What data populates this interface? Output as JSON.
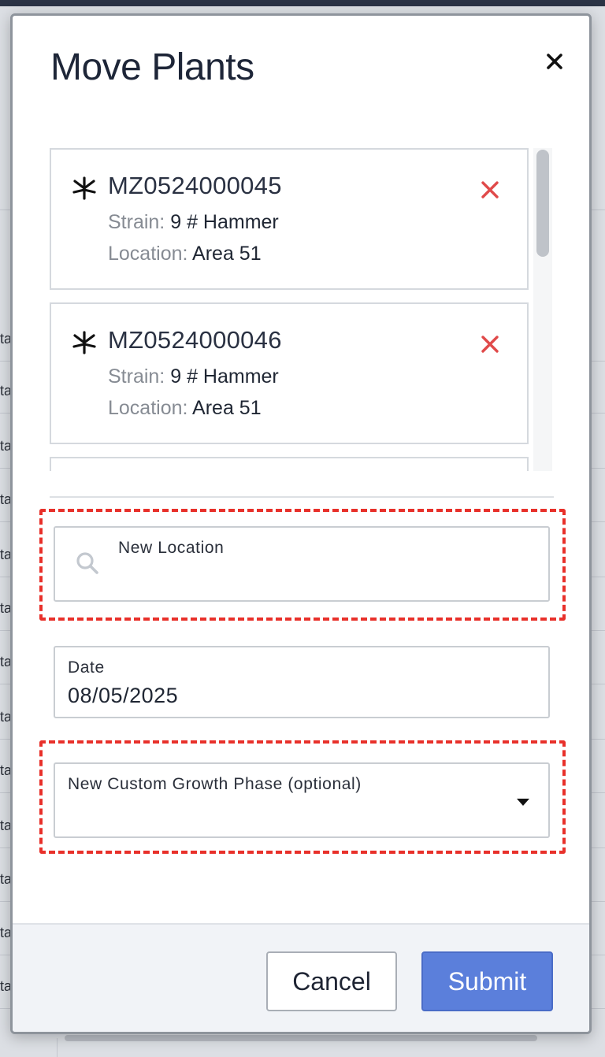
{
  "background": {
    "row_fragments": [
      "ta",
      "ta",
      "ta",
      "ta",
      "ta",
      "ta",
      "ta",
      "ta",
      "ta",
      "ta",
      "ta",
      "ta",
      "ta"
    ]
  },
  "modal": {
    "title": "Move Plants",
    "close_icon": "close-icon"
  },
  "plants": [
    {
      "id": "MZ0524000045",
      "strain_label": "Strain:",
      "strain": "9 # Hammer",
      "location_label": "Location:",
      "location": "Area 51"
    },
    {
      "id": "MZ0524000046",
      "strain_label": "Strain:",
      "strain": "9 # Hammer",
      "location_label": "Location:",
      "location": "Area 51"
    }
  ],
  "form": {
    "new_location": {
      "label": "New Location",
      "value": ""
    },
    "date": {
      "label": "Date",
      "value": "08/05/2025"
    },
    "growth_phase": {
      "label": "New Custom Growth Phase (optional)",
      "value": ""
    }
  },
  "footer": {
    "cancel_label": "Cancel",
    "submit_label": "Submit"
  },
  "colors": {
    "highlight": "#e8302a",
    "submit": "#5b7fdb",
    "remove": "#e04a4a"
  }
}
